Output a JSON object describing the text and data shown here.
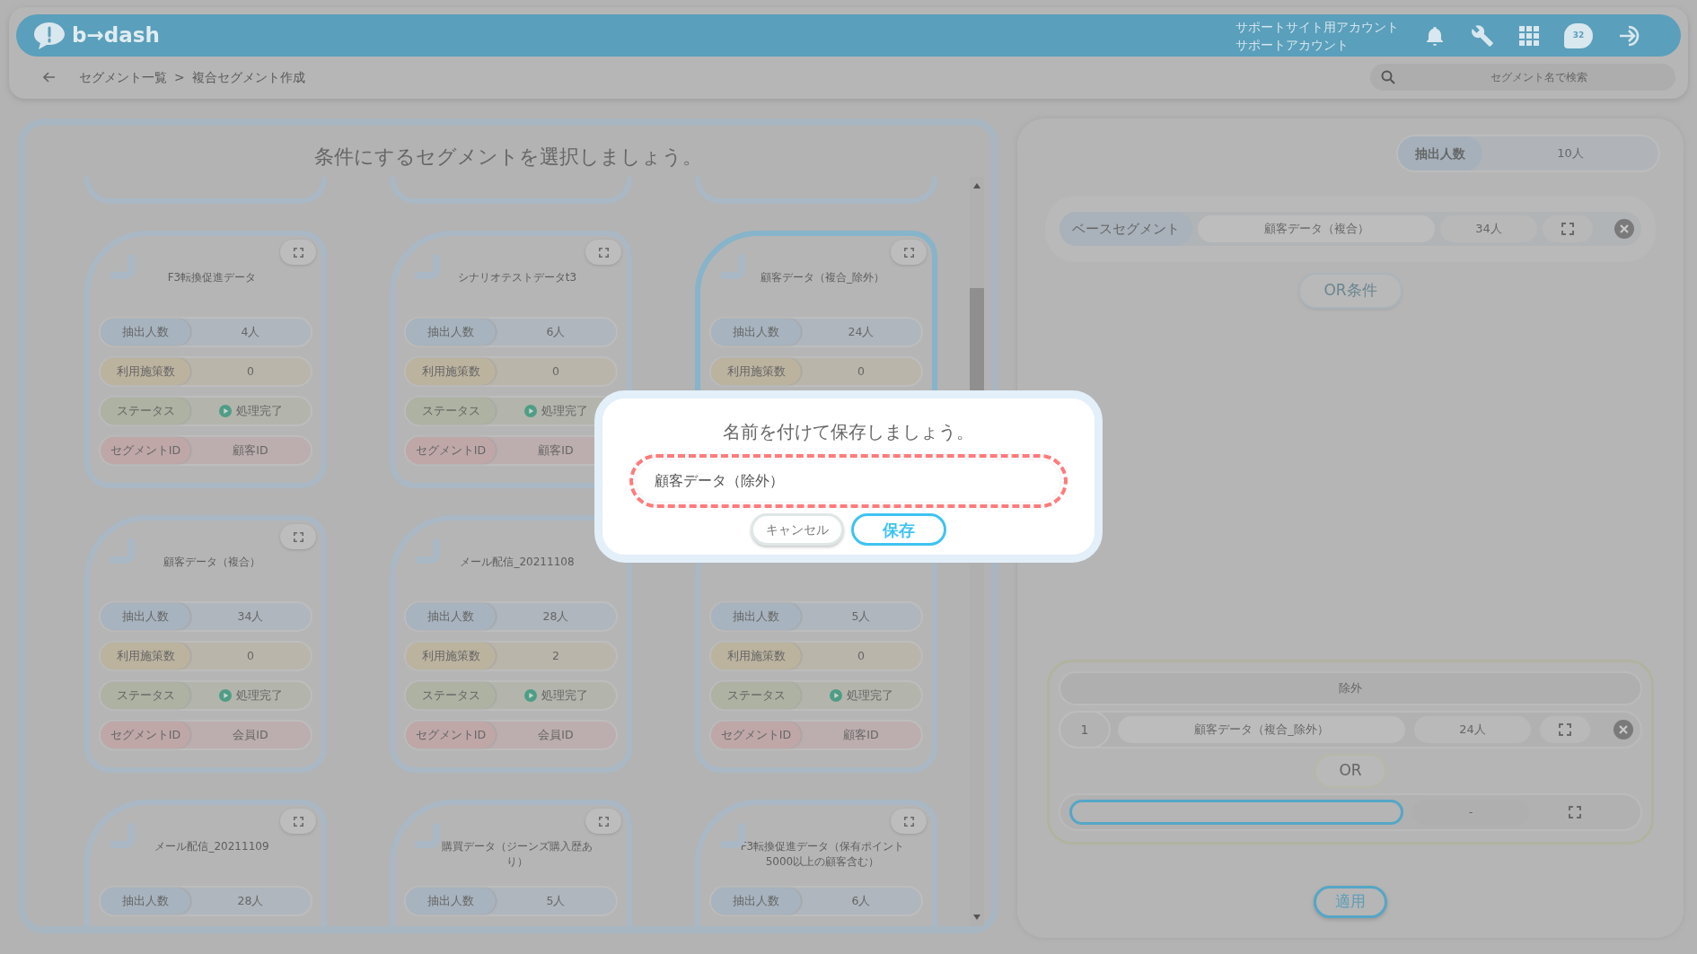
{
  "header": {
    "logo": "b→dash",
    "account": [
      "サポートサイト用アカウント",
      "サポートアカウント"
    ],
    "chat_badge": "32"
  },
  "breadcrumb": {
    "items": [
      "セグメント一覧",
      "複合セグメント作成"
    ],
    "separator": ">"
  },
  "search": {
    "placeholder": "セグメント名で検索"
  },
  "left_panel": {
    "title": "条件にするセグメントを選択しましょう。",
    "cards": [
      {
        "title": "F3転換促進データ",
        "selected": false,
        "expand_button": true,
        "stats": [
          {
            "kind": "count",
            "label": "抽出人数",
            "value": "4人"
          },
          {
            "kind": "campaigns",
            "label": "利用施策数",
            "value": "0"
          },
          {
            "kind": "status",
            "label": "ステータス",
            "value": "処理完了"
          },
          {
            "kind": "segment_id",
            "label": "セグメントID",
            "value": "顧客ID"
          }
        ]
      },
      {
        "title": "シナリオテストデータt3",
        "selected": false,
        "expand_button": true,
        "stats": [
          {
            "kind": "count",
            "label": "抽出人数",
            "value": "6人"
          },
          {
            "kind": "campaigns",
            "label": "利用施策数",
            "value": "0"
          },
          {
            "kind": "status",
            "label": "ステータス",
            "value": "処理完了"
          },
          {
            "kind": "segment_id",
            "label": "セグメントID",
            "value": "顧客ID"
          }
        ]
      },
      {
        "title": "顧客データ（複合_除外）",
        "selected": true,
        "expand_button": true,
        "stats": [
          {
            "kind": "count",
            "label": "抽出人数",
            "value": "24人"
          },
          {
            "kind": "campaigns",
            "label": "利用施策数",
            "value": "0"
          }
        ]
      },
      {
        "title": "顧客データ（複合）",
        "selected": false,
        "expand_button": true,
        "stats": [
          {
            "kind": "count",
            "label": "抽出人数",
            "value": "34人"
          },
          {
            "kind": "campaigns",
            "label": "利用施策数",
            "value": "0"
          },
          {
            "kind": "status",
            "label": "ステータス",
            "value": "処理完了"
          },
          {
            "kind": "segment_id",
            "label": "セグメントID",
            "value": "会員ID"
          }
        ]
      },
      {
        "title": "メール配信_20211108",
        "selected": false,
        "expand_button": false,
        "stats": [
          {
            "kind": "count",
            "label": "抽出人数",
            "value": "28人"
          },
          {
            "kind": "campaigns",
            "label": "利用施策数",
            "value": "2"
          },
          {
            "kind": "status",
            "label": "ステータス",
            "value": "処理完了"
          },
          {
            "kind": "segment_id",
            "label": "セグメントID",
            "value": "会員ID"
          }
        ]
      },
      {
        "selected": false,
        "expand_button": false,
        "stats": [
          {
            "kind": "count",
            "label": "抽出人数",
            "value": "5人"
          },
          {
            "kind": "campaigns",
            "label": "利用施策数",
            "value": "0"
          },
          {
            "kind": "status",
            "label": "ステータス",
            "value": "処理完了"
          },
          {
            "kind": "segment_id",
            "label": "セグメントID",
            "value": "顧客ID"
          }
        ]
      },
      {
        "title": "メール配信_20211109",
        "selected": false,
        "expand_button": true,
        "stats": [
          {
            "kind": "count",
            "label": "抽出人数",
            "value": "28人"
          }
        ]
      },
      {
        "title": "購買データ（ジーンズ購入歴あり）",
        "selected": false,
        "expand_button": true,
        "stats": [
          {
            "kind": "count",
            "label": "抽出人数",
            "value": "5人"
          }
        ]
      },
      {
        "title": "F3転換促進データ（保有ポイント5000以上の顧客含む）",
        "selected": false,
        "expand_button": true,
        "stats": [
          {
            "kind": "count",
            "label": "抽出人数",
            "value": "6人"
          }
        ]
      }
    ]
  },
  "right_panel": {
    "total": {
      "label": "抽出人数",
      "value": "10人"
    },
    "base": {
      "label": "ベースセグメント",
      "name": "顧客データ（複合）",
      "count": "34人"
    },
    "or_condition_button": "OR条件",
    "exclusion": {
      "title": "除外",
      "rows": [
        {
          "index": "1",
          "name": "顧客データ（複合_除外）",
          "count": "24人"
        }
      ],
      "or_label": "OR",
      "empty_row": {
        "count": "-"
      }
    },
    "apply_button": "適用"
  },
  "modal": {
    "title": "名前を付けて保存しましょう。",
    "input_value": "顧客データ（除外）",
    "buttons": [
      {
        "kind": "cancel",
        "label": "キャンセル"
      },
      {
        "kind": "primary",
        "label": "保存"
      }
    ]
  }
}
